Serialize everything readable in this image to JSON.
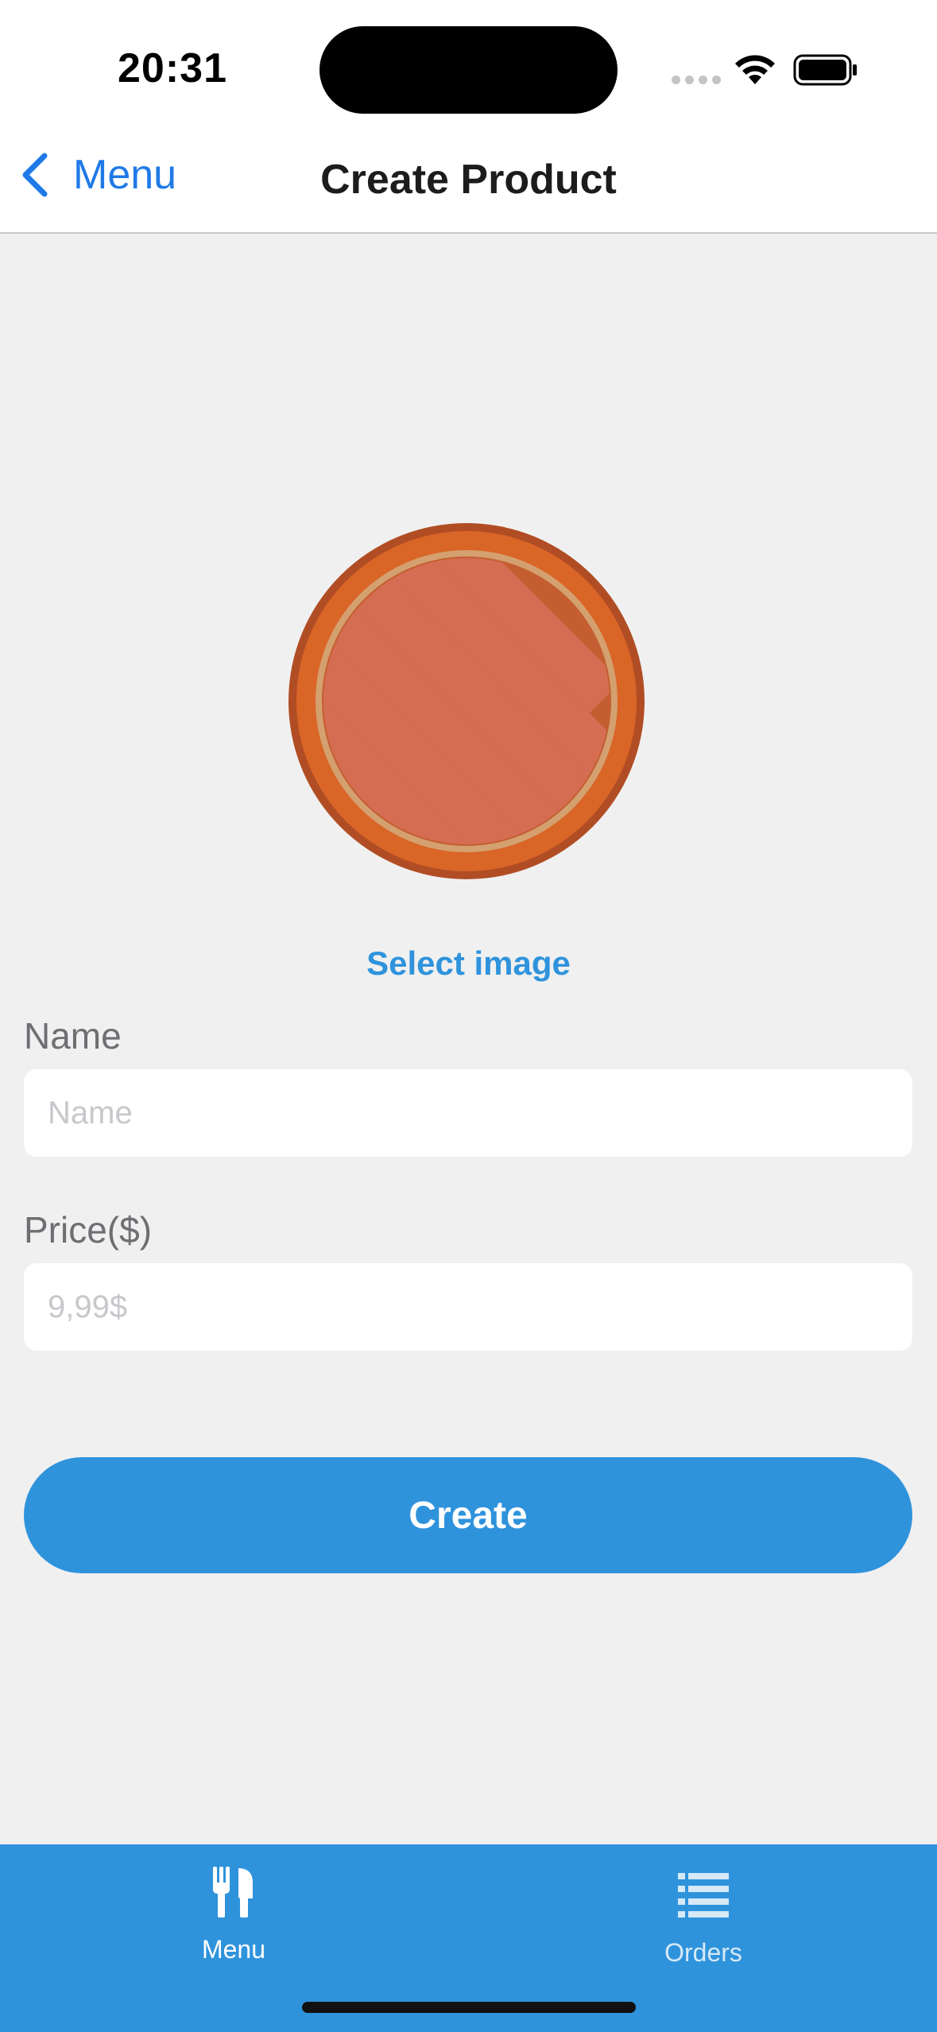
{
  "status_bar": {
    "time": "20:31"
  },
  "nav": {
    "back_label": "Menu",
    "title": "Create Product"
  },
  "product_image": {
    "select_label": "Select image",
    "icon": "pizza-placeholder-image"
  },
  "form": {
    "name": {
      "label": "Name",
      "placeholder": "Name",
      "value": ""
    },
    "price": {
      "label": "Price($)",
      "placeholder": "9,99$",
      "value": ""
    },
    "create_label": "Create"
  },
  "tab_bar": {
    "items": [
      {
        "label": "Menu",
        "icon": "fork-knife-icon",
        "active": true
      },
      {
        "label": "Orders",
        "icon": "list-icon",
        "active": false
      }
    ]
  },
  "colors": {
    "accent": "#2f93dc",
    "nav_link": "#1f7ae8",
    "background": "#f0f0f0"
  }
}
